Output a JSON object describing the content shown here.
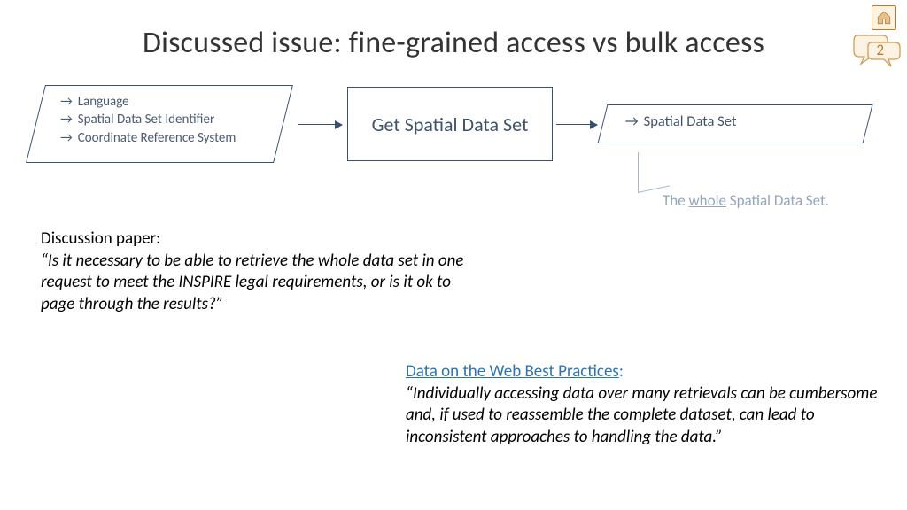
{
  "title": "Discussed issue: fine-grained access vs bulk access",
  "bubble_number": "2",
  "diagram": {
    "inputs": [
      "Language",
      "Spatial Data Set Identifier",
      "Coordinate Reference System"
    ],
    "center": "Get Spatial Data Set",
    "output": "Spatial Data Set",
    "annotation_prefix": "The ",
    "annotation_underlined": "whole",
    "annotation_suffix": " Spatial Data Set."
  },
  "discussion": {
    "heading": "Discussion paper:",
    "quote": "“Is it necessary to be able to retrieve the whole data set in one request to meet the INSPIRE legal requirements, or is it ok to page through the results?”"
  },
  "best_practices": {
    "link_text": "Data on the Web Best Practices",
    "colon": ":",
    "quote": "“Individually accessing data over many retrievals can be cumbersome and, if used to reassemble the complete dataset, can lead to inconsistent approaches to handling the data.”"
  }
}
